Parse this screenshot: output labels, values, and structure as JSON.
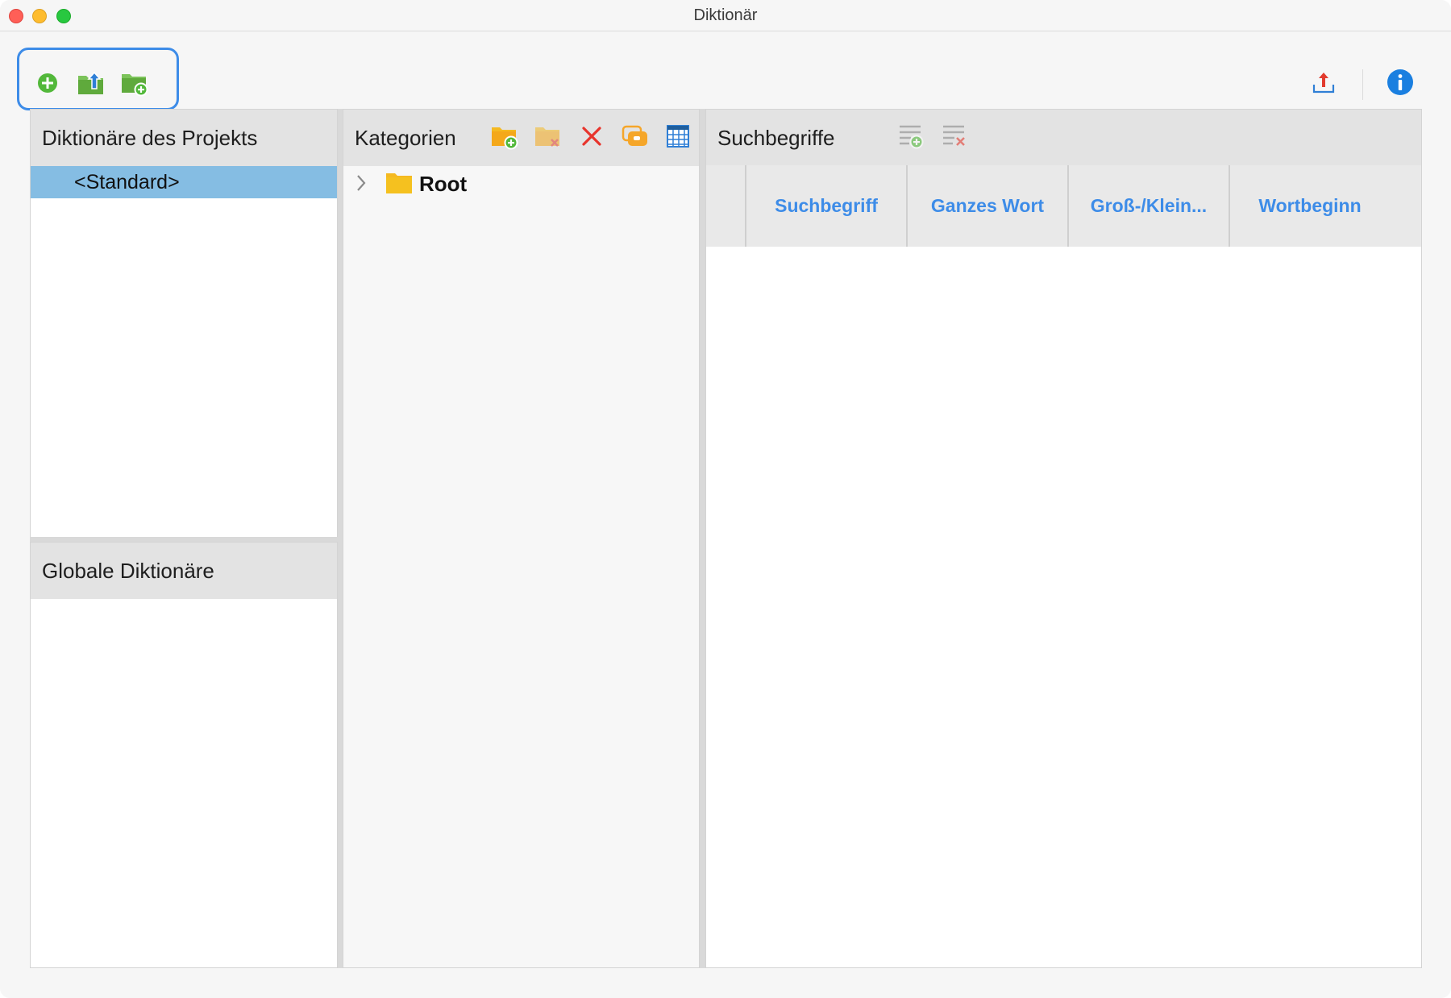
{
  "window": {
    "title": "Diktionär"
  },
  "toolbar": {
    "left_icons": [
      "add-circle-icon",
      "folder-import-icon",
      "folder-add-icon"
    ],
    "right_icons": [
      "export-icon",
      "info-icon"
    ]
  },
  "project_dictionaries": {
    "title": "Diktionäre des Projekts",
    "items": [
      {
        "label": "<Standard>",
        "selected": true
      }
    ]
  },
  "global_dictionaries": {
    "title": "Globale Diktionäre",
    "items": []
  },
  "categories": {
    "title": "Kategorien",
    "toolbar_icons": [
      "new-category-icon",
      "delete-category-icon",
      "delete-icon",
      "duplicate-icon",
      "table-icon"
    ],
    "tree": [
      {
        "label": "Root",
        "expanded": false
      }
    ]
  },
  "search_terms": {
    "title": "Suchbegriffe",
    "toolbar_icons": [
      "add-term-icon",
      "delete-term-icon"
    ],
    "columns": [
      "Suchbegriff",
      "Ganzes Wort",
      "Groß-/Klein...",
      "Wortbeginn"
    ],
    "rows": []
  },
  "colors": {
    "accent": "#3d8ce8",
    "selection": "#85bde3",
    "header_bg": "#e3e3e3"
  }
}
